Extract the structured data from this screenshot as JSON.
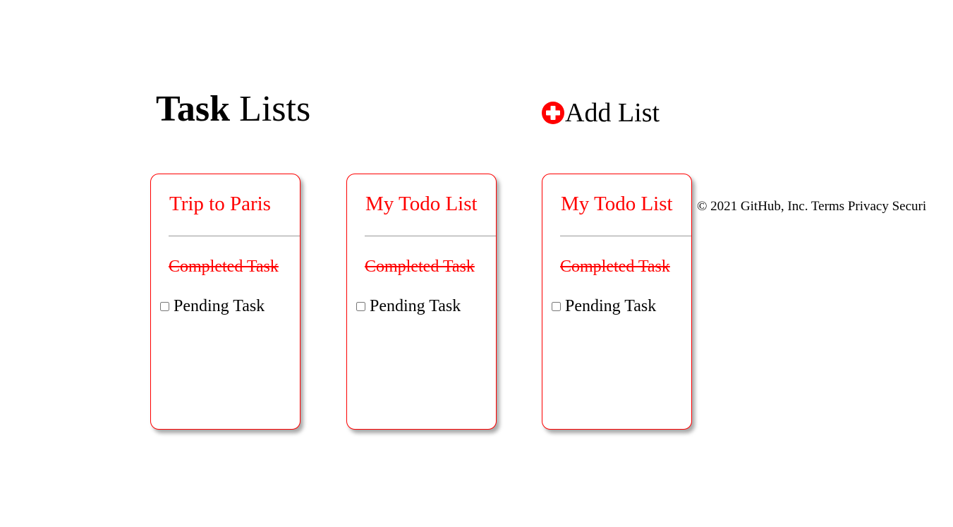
{
  "header": {
    "title_bold": "Task",
    "title_rest": " Lists",
    "add_list_label": "Add List"
  },
  "lists": [
    {
      "title": "Trip to Paris",
      "completed_task": "Completed Task",
      "pending_task": "Pending Task",
      "pending_checked": false
    },
    {
      "title": "My Todo List",
      "completed_task": "Completed Task",
      "pending_task": "Pending Task",
      "pending_checked": false
    },
    {
      "title": "My Todo List",
      "completed_task": "Completed Task",
      "pending_task": "Pending Task",
      "pending_checked": false
    }
  ],
  "footer": {
    "text": "© 2021 GitHub, Inc. Terms Privacy Securi"
  },
  "colors": {
    "accent": "#ff0000",
    "divider": "#9a9a9a"
  },
  "icons": {
    "add_list": "plus-circle-icon"
  }
}
